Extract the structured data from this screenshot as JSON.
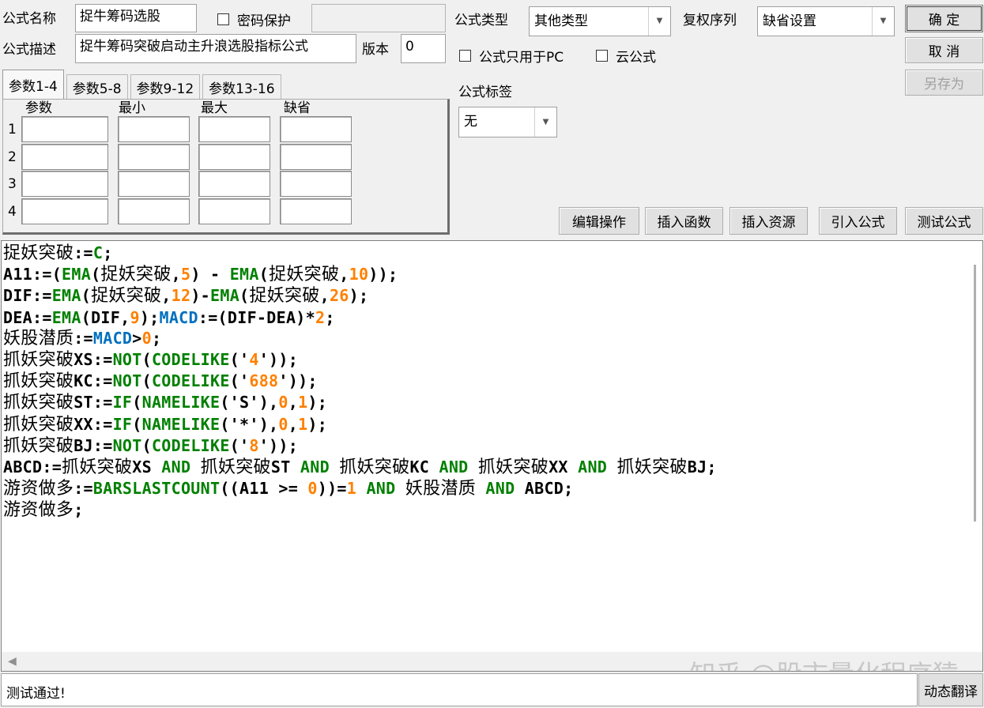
{
  "form": {
    "name_label": "公式名称",
    "name_value": "捉牛筹码选股",
    "password_label": "密码保护",
    "password_value": "",
    "type_label": "公式类型",
    "type_value": "其他类型",
    "rights_label": "复权序列",
    "rights_value": "缺省设置",
    "desc_label": "公式描述",
    "desc_value": "捉牛筹码突破启动主升浪选股指标公式",
    "version_label": "版本",
    "version_value": "0",
    "pc_only_label": "公式只用于PC",
    "cloud_label": "云公式",
    "tag_label": "公式标签",
    "tag_value": "无"
  },
  "buttons": {
    "ok": "确  定",
    "cancel": "取  消",
    "save_as": "另存为",
    "edit_ops": "编辑操作",
    "insert_func": "插入函数",
    "insert_resource": "插入资源",
    "import_formula": "引入公式",
    "test_formula": "测试公式",
    "dynamic_translate": "动态翻译"
  },
  "params": {
    "tabs": [
      "参数1-4",
      "参数5-8",
      "参数9-12",
      "参数13-16"
    ],
    "headers": [
      "参数",
      "最小",
      "最大",
      "缺省"
    ],
    "rows": [
      "1",
      "2",
      "3",
      "4"
    ]
  },
  "code_lines": [
    [
      [
        "cn",
        "捉妖突破"
      ],
      [
        "k",
        ":="
      ],
      [
        "g",
        "C"
      ],
      [
        "k",
        ";"
      ]
    ],
    [
      [
        "k",
        "A11:=("
      ],
      [
        "g",
        "EMA"
      ],
      [
        "k",
        "("
      ],
      [
        "cn",
        "捉妖突破"
      ],
      [
        "k",
        ","
      ],
      [
        "o",
        "5"
      ],
      [
        "k",
        ") - "
      ],
      [
        "g",
        "EMA"
      ],
      [
        "k",
        "("
      ],
      [
        "cn",
        "捉妖突破"
      ],
      [
        "k",
        ","
      ],
      [
        "o",
        "10"
      ],
      [
        "k",
        "));"
      ]
    ],
    [
      [
        "k",
        "DIF:="
      ],
      [
        "g",
        "EMA"
      ],
      [
        "k",
        "("
      ],
      [
        "cn",
        "捉妖突破"
      ],
      [
        "k",
        ","
      ],
      [
        "o",
        "12"
      ],
      [
        "k",
        ")-"
      ],
      [
        "g",
        "EMA"
      ],
      [
        "k",
        "("
      ],
      [
        "cn",
        "捉妖突破"
      ],
      [
        "k",
        ","
      ],
      [
        "o",
        "26"
      ],
      [
        "k",
        ");"
      ]
    ],
    [
      [
        "k",
        "DEA:="
      ],
      [
        "g",
        "EMA"
      ],
      [
        "k",
        "(DIF,"
      ],
      [
        "o",
        "9"
      ],
      [
        "k",
        ");"
      ],
      [
        "b",
        "MACD"
      ],
      [
        "k",
        ":=(DIF-DEA)*"
      ],
      [
        "o",
        "2"
      ],
      [
        "k",
        ";"
      ]
    ],
    [
      [
        "cn",
        "妖股潜质"
      ],
      [
        "k",
        ":="
      ],
      [
        "b",
        "MACD"
      ],
      [
        "k",
        ">"
      ],
      [
        "o",
        "0"
      ],
      [
        "k",
        ";"
      ]
    ],
    [
      [
        "cn",
        "抓妖突破"
      ],
      [
        "k",
        "XS:="
      ],
      [
        "g",
        "NOT"
      ],
      [
        "k",
        "("
      ],
      [
        "g",
        "CODELIKE"
      ],
      [
        "k",
        "('"
      ],
      [
        "o",
        "4"
      ],
      [
        "k",
        "'));"
      ]
    ],
    [
      [
        "cn",
        "抓妖突破"
      ],
      [
        "k",
        "KC:="
      ],
      [
        "g",
        "NOT"
      ],
      [
        "k",
        "("
      ],
      [
        "g",
        "CODELIKE"
      ],
      [
        "k",
        "('"
      ],
      [
        "o",
        "688"
      ],
      [
        "k",
        "'));"
      ]
    ],
    [
      [
        "cn",
        "抓妖突破"
      ],
      [
        "k",
        "ST:="
      ],
      [
        "g",
        "IF"
      ],
      [
        "k",
        "("
      ],
      [
        "g",
        "NAMELIKE"
      ],
      [
        "k",
        "('S'),"
      ],
      [
        "o",
        "0"
      ],
      [
        "k",
        ","
      ],
      [
        "o",
        "1"
      ],
      [
        "k",
        ");"
      ]
    ],
    [
      [
        "cn",
        "抓妖突破"
      ],
      [
        "k",
        "XX:="
      ],
      [
        "g",
        "IF"
      ],
      [
        "k",
        "("
      ],
      [
        "g",
        "NAMELIKE"
      ],
      [
        "k",
        "('*'),"
      ],
      [
        "o",
        "0"
      ],
      [
        "k",
        ","
      ],
      [
        "o",
        "1"
      ],
      [
        "k",
        ");"
      ]
    ],
    [
      [
        "cn",
        "抓妖突破"
      ],
      [
        "k",
        "BJ:="
      ],
      [
        "g",
        "NOT"
      ],
      [
        "k",
        "("
      ],
      [
        "g",
        "CODELIKE"
      ],
      [
        "k",
        "('"
      ],
      [
        "o",
        "8"
      ],
      [
        "k",
        "'));"
      ]
    ],
    [
      [
        "k",
        "ABCD:="
      ],
      [
        "cn",
        "抓妖突破"
      ],
      [
        "k",
        "XS "
      ],
      [
        "g",
        "AND"
      ],
      [
        "k",
        " "
      ],
      [
        "cn",
        "抓妖突破"
      ],
      [
        "k",
        "ST "
      ],
      [
        "g",
        "AND"
      ],
      [
        "k",
        " "
      ],
      [
        "cn",
        "抓妖突破"
      ],
      [
        "k",
        "KC "
      ],
      [
        "g",
        "AND"
      ],
      [
        "k",
        " "
      ],
      [
        "cn",
        "抓妖突破"
      ],
      [
        "k",
        "XX "
      ],
      [
        "g",
        "AND"
      ],
      [
        "k",
        " "
      ],
      [
        "cn",
        "抓妖突破"
      ],
      [
        "k",
        "BJ;"
      ]
    ],
    [
      [
        "cn",
        "游资做多"
      ],
      [
        "k",
        ":="
      ],
      [
        "g",
        "BARSLASTCOUNT"
      ],
      [
        "k",
        "((A11 >= "
      ],
      [
        "o",
        "0"
      ],
      [
        "k",
        "))="
      ],
      [
        "o",
        "1"
      ],
      [
        "k",
        " "
      ],
      [
        "g",
        "AND"
      ],
      [
        "k",
        " "
      ],
      [
        "cn",
        "妖股潜质"
      ],
      [
        "k",
        " "
      ],
      [
        "g",
        "AND"
      ],
      [
        "k",
        " ABCD;"
      ]
    ],
    [
      [
        "cn",
        "游资做多"
      ],
      [
        "k",
        ";"
      ]
    ]
  ],
  "watermark": "知乎 @股市量化程序猿",
  "status_text": "测试通过!",
  "colors": {
    "keyword": "#008000",
    "variable": "#0070c0",
    "number": "#ff8000",
    "text": "#000000"
  }
}
